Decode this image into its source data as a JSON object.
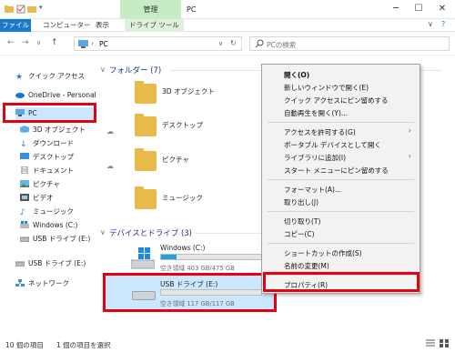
{
  "window": {
    "title": "PC",
    "manage_tab": "管理",
    "minimize": "─",
    "maximize": "☐",
    "close": "✕"
  },
  "ribbon": {
    "tabs": [
      "ファイル",
      "コンピューター",
      "表示",
      "ドライブ ツール"
    ],
    "expand": "∨",
    "help": "?"
  },
  "address": {
    "path": "PC",
    "separator": "›",
    "search_placeholder": "PCの検索"
  },
  "nav": {
    "quick_access": "クイック アクセス",
    "onedrive": "OneDrive - Personal",
    "pc": "PC",
    "items": [
      "3D オブジェクト",
      "ダウンロード",
      "デスクトップ",
      "ドキュメント",
      "ピクチャ",
      "ビデオ",
      "ミュージック",
      "Windows (C:)",
      "USB ドライブ (E:)"
    ],
    "usb_drive": "USB ドライブ (E:)",
    "network": "ネットワーク"
  },
  "folders": {
    "header": "フォルダー (7)",
    "items": [
      "3D オブジェクト",
      "デスクトップ",
      "ピクチャ",
      "ミュージック"
    ]
  },
  "drives": {
    "header": "デバイスとドライブ (3)",
    "items": [
      {
        "name": "Windows (C:)",
        "free": "空き領域 403 GB/475 GB",
        "used_fraction": 0.15
      },
      {
        "name": "USB ドライブ (E:)",
        "free": "空き領域 117 GB/117 GB",
        "used_fraction": 0.0
      }
    ]
  },
  "context_menu": {
    "items": [
      "開く(O)",
      "新しいウィンドウで開く(E)",
      "クイック アクセスにピン留めする",
      "自動再生を開く(Y)...",
      "アクセスを許可する(G)",
      "ポータブル デバイスとして開く",
      "ライブラリに追加(I)",
      "スタート メニューにピン留めする",
      "フォーマット(A)...",
      "取り出し(J)",
      "切り取り(T)",
      "コピー(C)",
      "ショートカットの作成(S)",
      "名前の変更(M)",
      "プロパティ(R)"
    ]
  },
  "status": {
    "count": "10 個の項目",
    "selected": "1 個の項目を選択"
  },
  "colors": {
    "accent": "#1979ca",
    "highlight_red": "#e60012",
    "manage_green": "#c7ecc4",
    "selection_blue": "#cce8ff",
    "bar_fill": "#26a0da"
  }
}
